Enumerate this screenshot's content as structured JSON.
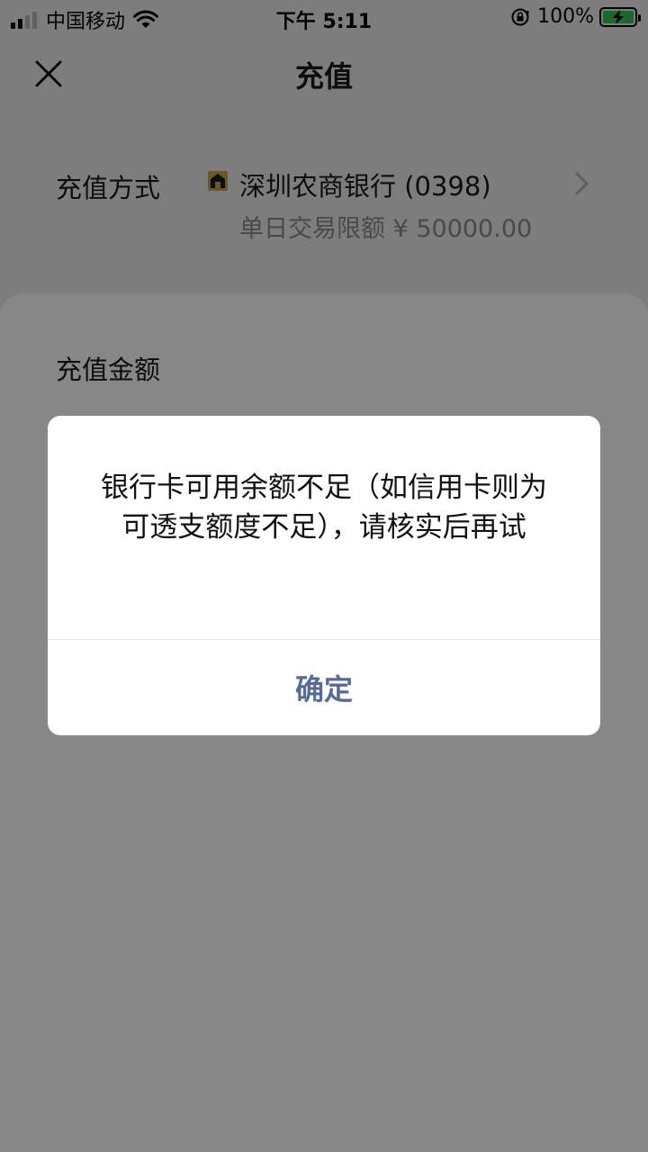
{
  "status_bar": {
    "carrier": "中国移动",
    "time": "下午 5:11",
    "battery": "100%",
    "signal_bars_active": 2,
    "icons": [
      "signal-icon",
      "wifi-icon",
      "rotation-lock-icon",
      "battery-charging-icon"
    ]
  },
  "nav": {
    "title": "充值",
    "close_icon": "close-icon"
  },
  "method": {
    "label": "充值方式",
    "bank_name": "深圳农商银行 (0398)",
    "limit": "单日交易限额 ¥ 50000.00",
    "logo_icon": "bank-logo-icon",
    "chevron_icon": "chevron-right-icon"
  },
  "amount": {
    "label": "充值金额"
  },
  "dialog": {
    "message": "银行卡可用余额不足（如信用卡则为可透支额度不足），请核实后再试",
    "confirm": "确定"
  },
  "colors": {
    "accent": "#576b95",
    "battery": "#34c759",
    "mask": "rgba(0,0,0,0.47)"
  }
}
